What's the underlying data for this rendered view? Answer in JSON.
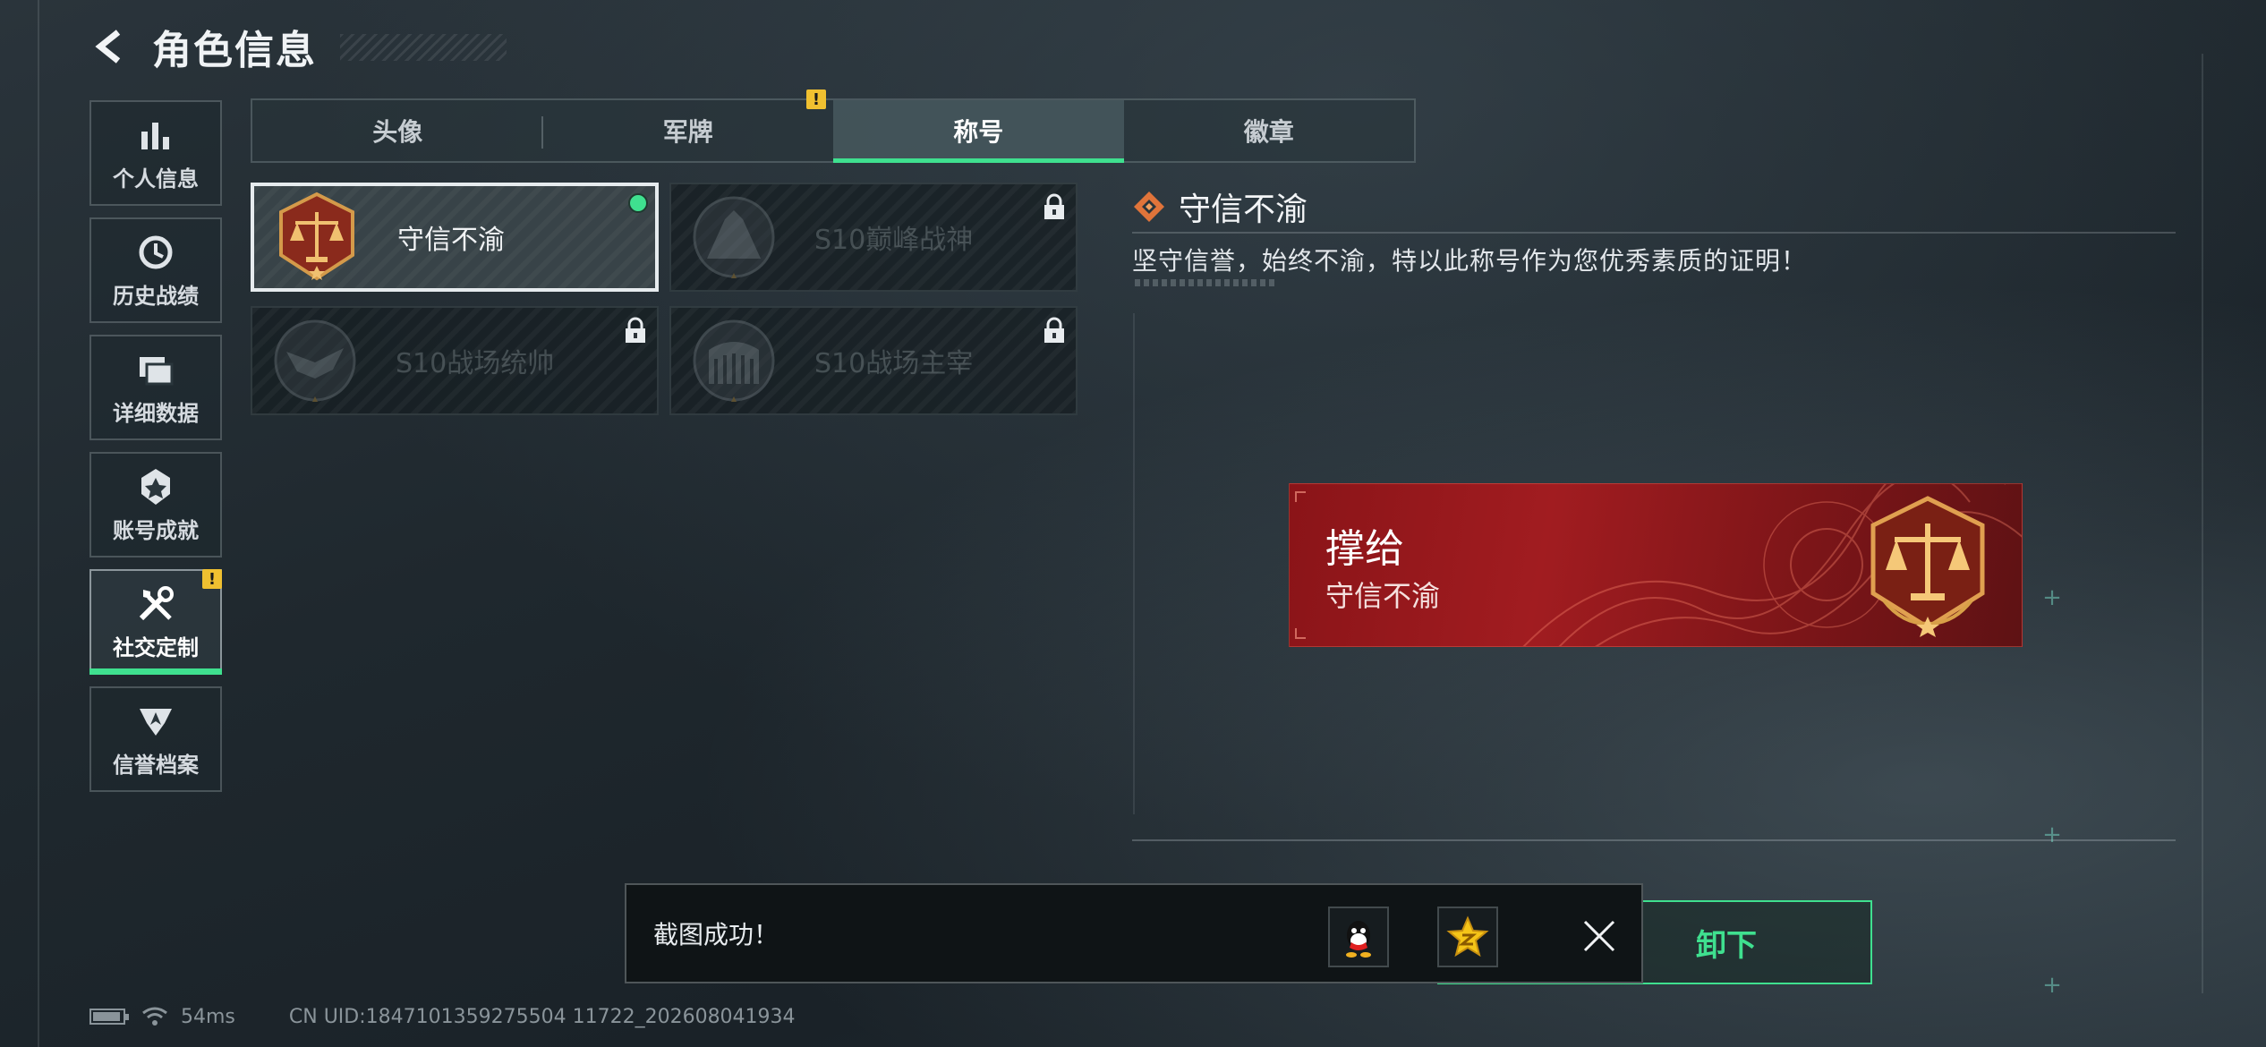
{
  "header": {
    "title": "角色信息"
  },
  "sidebar": {
    "items": [
      {
        "label": "个人信息",
        "icon": "bar-chart-icon"
      },
      {
        "label": "历史战绩",
        "icon": "history-clock-icon"
      },
      {
        "label": "详细数据",
        "icon": "folders-icon"
      },
      {
        "label": "账号成就",
        "icon": "achievement-badge-icon"
      },
      {
        "label": "社交定制",
        "icon": "tools-icon",
        "active": true,
        "badge": "!"
      },
      {
        "label": "信誉档案",
        "icon": "credit-shield-icon"
      }
    ]
  },
  "tabs": [
    {
      "label": "头像"
    },
    {
      "label": "军牌",
      "badge": "!"
    },
    {
      "label": "称号",
      "active": true
    },
    {
      "label": "徽章"
    }
  ],
  "cards": [
    {
      "name": "守信不渝",
      "selected": true,
      "equipped": true,
      "locked": false
    },
    {
      "name": "S10巅峰战神",
      "locked": true
    },
    {
      "name": "S10战场统帅",
      "locked": true
    },
    {
      "name": "S10战场主宰",
      "locked": true
    }
  ],
  "detail": {
    "title": "守信不渝",
    "description": "坚守信誉，始终不渝，特以此称号作为您优秀素质的证明！"
  },
  "preview": {
    "player_name": "撑给",
    "title_text": "守信不渝"
  },
  "action_button": {
    "label": "卸下"
  },
  "toast": {
    "message": "截图成功！",
    "share_targets": [
      "qq-icon",
      "qzone-star-icon"
    ]
  },
  "status": {
    "ping": "54ms",
    "uid": "CN UID:1847101359275504 11722_202608041934"
  },
  "colors": {
    "accent": "#3fe08f",
    "warning": "#f0c030",
    "banner_red": "#a11c20"
  }
}
